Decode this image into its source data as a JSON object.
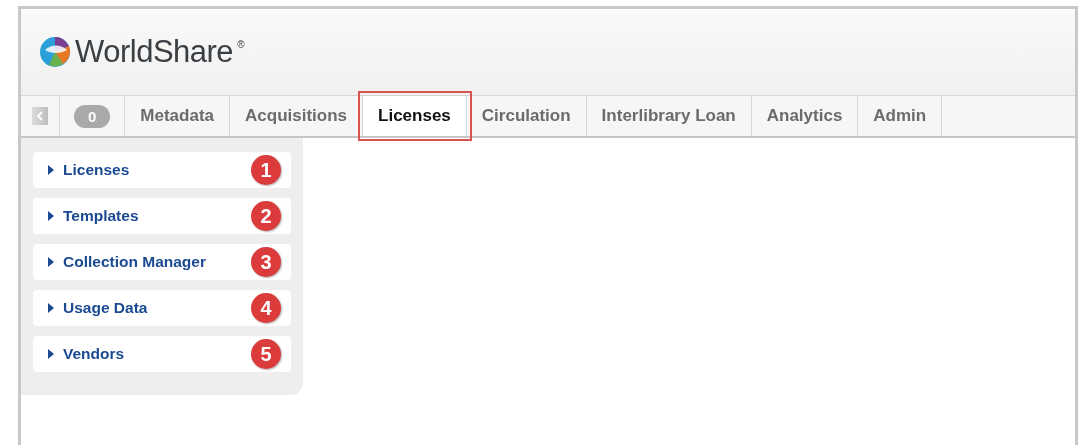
{
  "brand": {
    "name": "WorldShare",
    "mark": "®"
  },
  "nav": {
    "count": "0",
    "tabs": [
      {
        "label": "Metadata",
        "selected": false,
        "highlighted": false
      },
      {
        "label": "Acquisitions",
        "selected": false,
        "highlighted": false
      },
      {
        "label": "Licenses",
        "selected": true,
        "highlighted": true
      },
      {
        "label": "Circulation",
        "selected": false,
        "highlighted": false
      },
      {
        "label": "Interlibrary Loan",
        "selected": false,
        "highlighted": false
      },
      {
        "label": "Analytics",
        "selected": false,
        "highlighted": false
      },
      {
        "label": "Admin",
        "selected": false,
        "highlighted": false
      }
    ]
  },
  "sidebar": {
    "items": [
      {
        "label": "Licenses",
        "badge": "1",
        "expanded": false
      },
      {
        "label": "Templates",
        "badge": "2",
        "expanded": false
      },
      {
        "label": "Collection Manager",
        "badge": "3",
        "expanded": false
      },
      {
        "label": "Usage Data",
        "badge": "4",
        "expanded": false
      },
      {
        "label": "Vendors",
        "badge": "5",
        "expanded": false
      }
    ]
  }
}
